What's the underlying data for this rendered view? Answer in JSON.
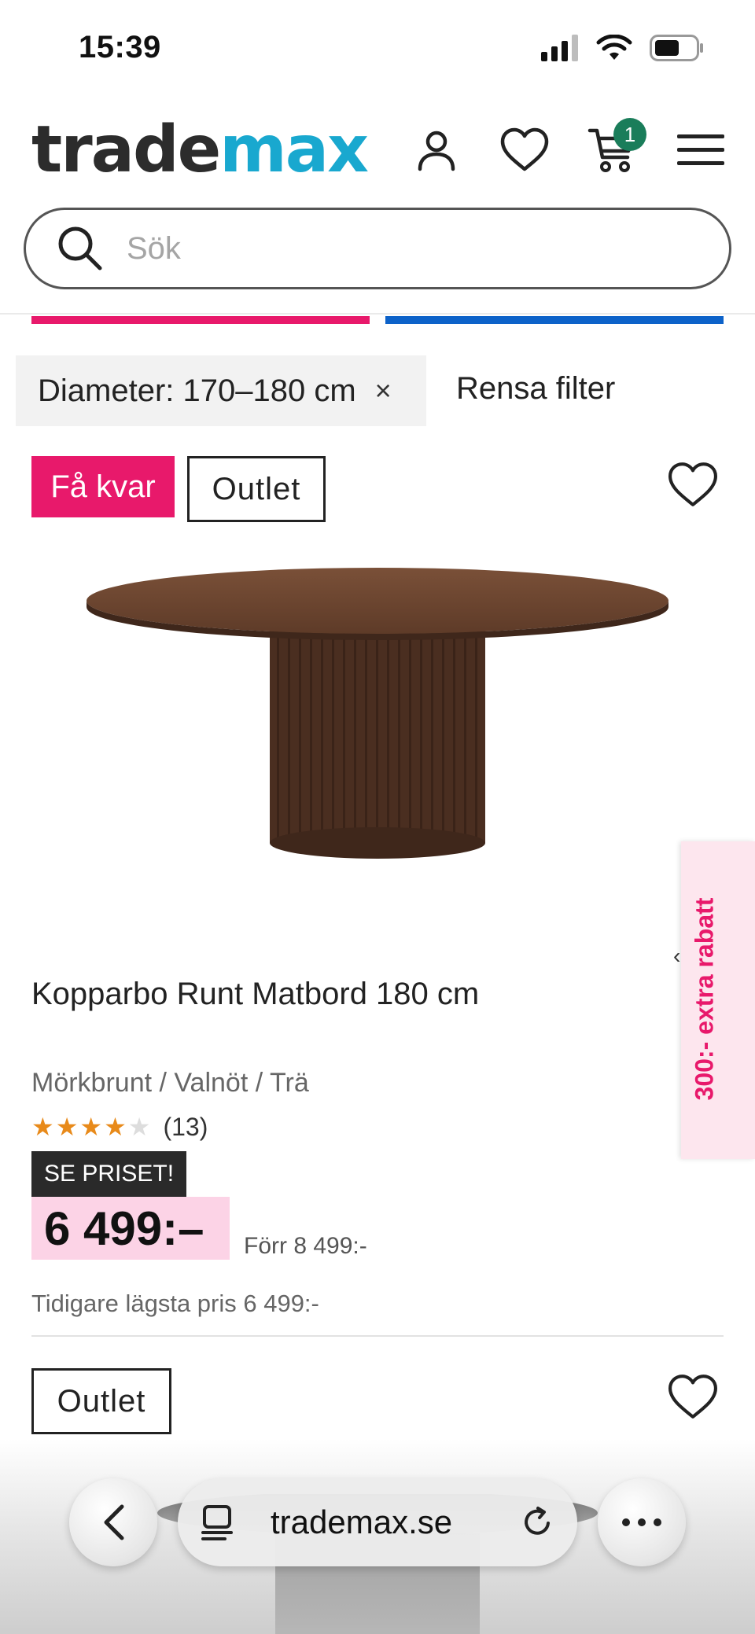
{
  "status_bar": {
    "time": "15:39"
  },
  "header": {
    "logo_part1": "trade",
    "logo_part2": "max",
    "cart_count": "1"
  },
  "search": {
    "placeholder": "Sök"
  },
  "filters": {
    "active_filter": "Diameter: 170–180 cm",
    "remove_symbol": "×",
    "clear_label": "Rensa filter"
  },
  "products": [
    {
      "badges": [
        "Få kvar",
        "Outlet"
      ],
      "title": "Kopparbo Runt Matbord 180 cm",
      "variant": "Mörkbrunt / Valnöt / Trä",
      "rating": 4,
      "rating_max": 5,
      "stars_on": "★★★★",
      "stars_off": "★",
      "review_count": "(13)",
      "campaign_label": "SE PRISET!",
      "price": "6 499:–",
      "previous_price": "Förr 8 499:-",
      "lowest_price": "Tidigare lägsta pris 6 499:-",
      "colors": {
        "tabletop": "#5e3b28",
        "base": "#4a2e20"
      }
    },
    {
      "badges": [
        "Outlet"
      ]
    }
  ],
  "side_tab": {
    "label": "300:- extra rabatt"
  },
  "browser": {
    "url": "trademax.se"
  },
  "colors": {
    "accent_pink": "#e8196b",
    "accent_blue": "#0d62c9",
    "logo_blue": "#19a8cf",
    "badge_green": "#1a7d5a",
    "price_bg": "#fcd3e6"
  }
}
